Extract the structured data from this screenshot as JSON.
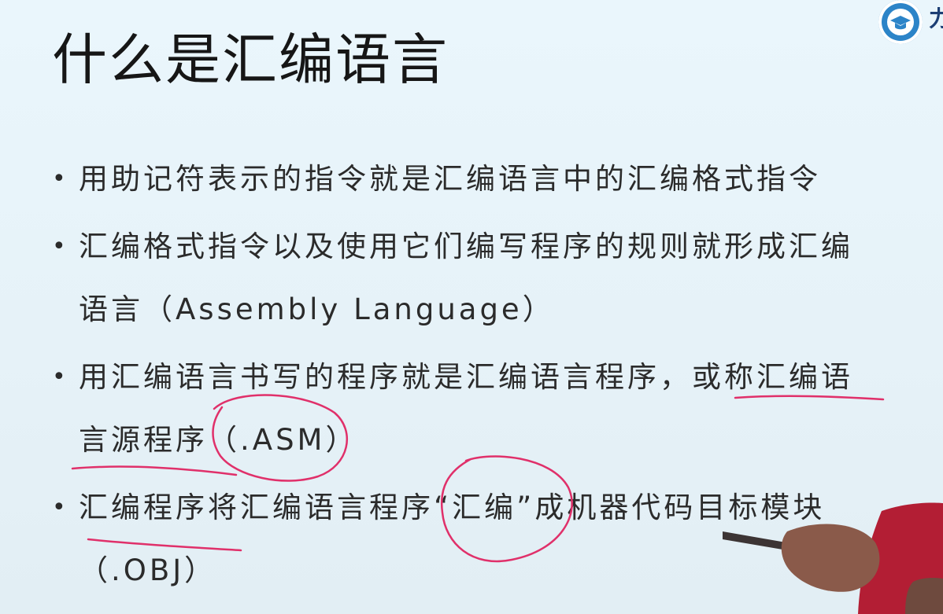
{
  "slide": {
    "title": "什么是汇编语言",
    "bullets": [
      {
        "lines": [
          "用助记符表示的指令就是汇编语言中的汇编格式指令"
        ]
      },
      {
        "lines": [
          "汇编格式指令以及使用它们编写程序的规则就形成汇编",
          "语言（Assembly Language）"
        ]
      },
      {
        "lines": [
          "用汇编语言书写的程序就是汇编语言程序，或称汇编语",
          "言源程序（.ASM）"
        ]
      },
      {
        "lines": [
          "汇编程序将汇编语言程序“汇编”成机器代码目标模块",
          "（.OBJ）"
        ]
      }
    ],
    "bullet_symbol": "•"
  },
  "logo": {
    "icon": "graduation-cap-icon",
    "edge_text": "力"
  },
  "colors": {
    "background": "#e8f4fa",
    "text": "#2b2b2b",
    "title": "#161616",
    "annotation": "#e0306a",
    "logo": "#2c84c8"
  }
}
